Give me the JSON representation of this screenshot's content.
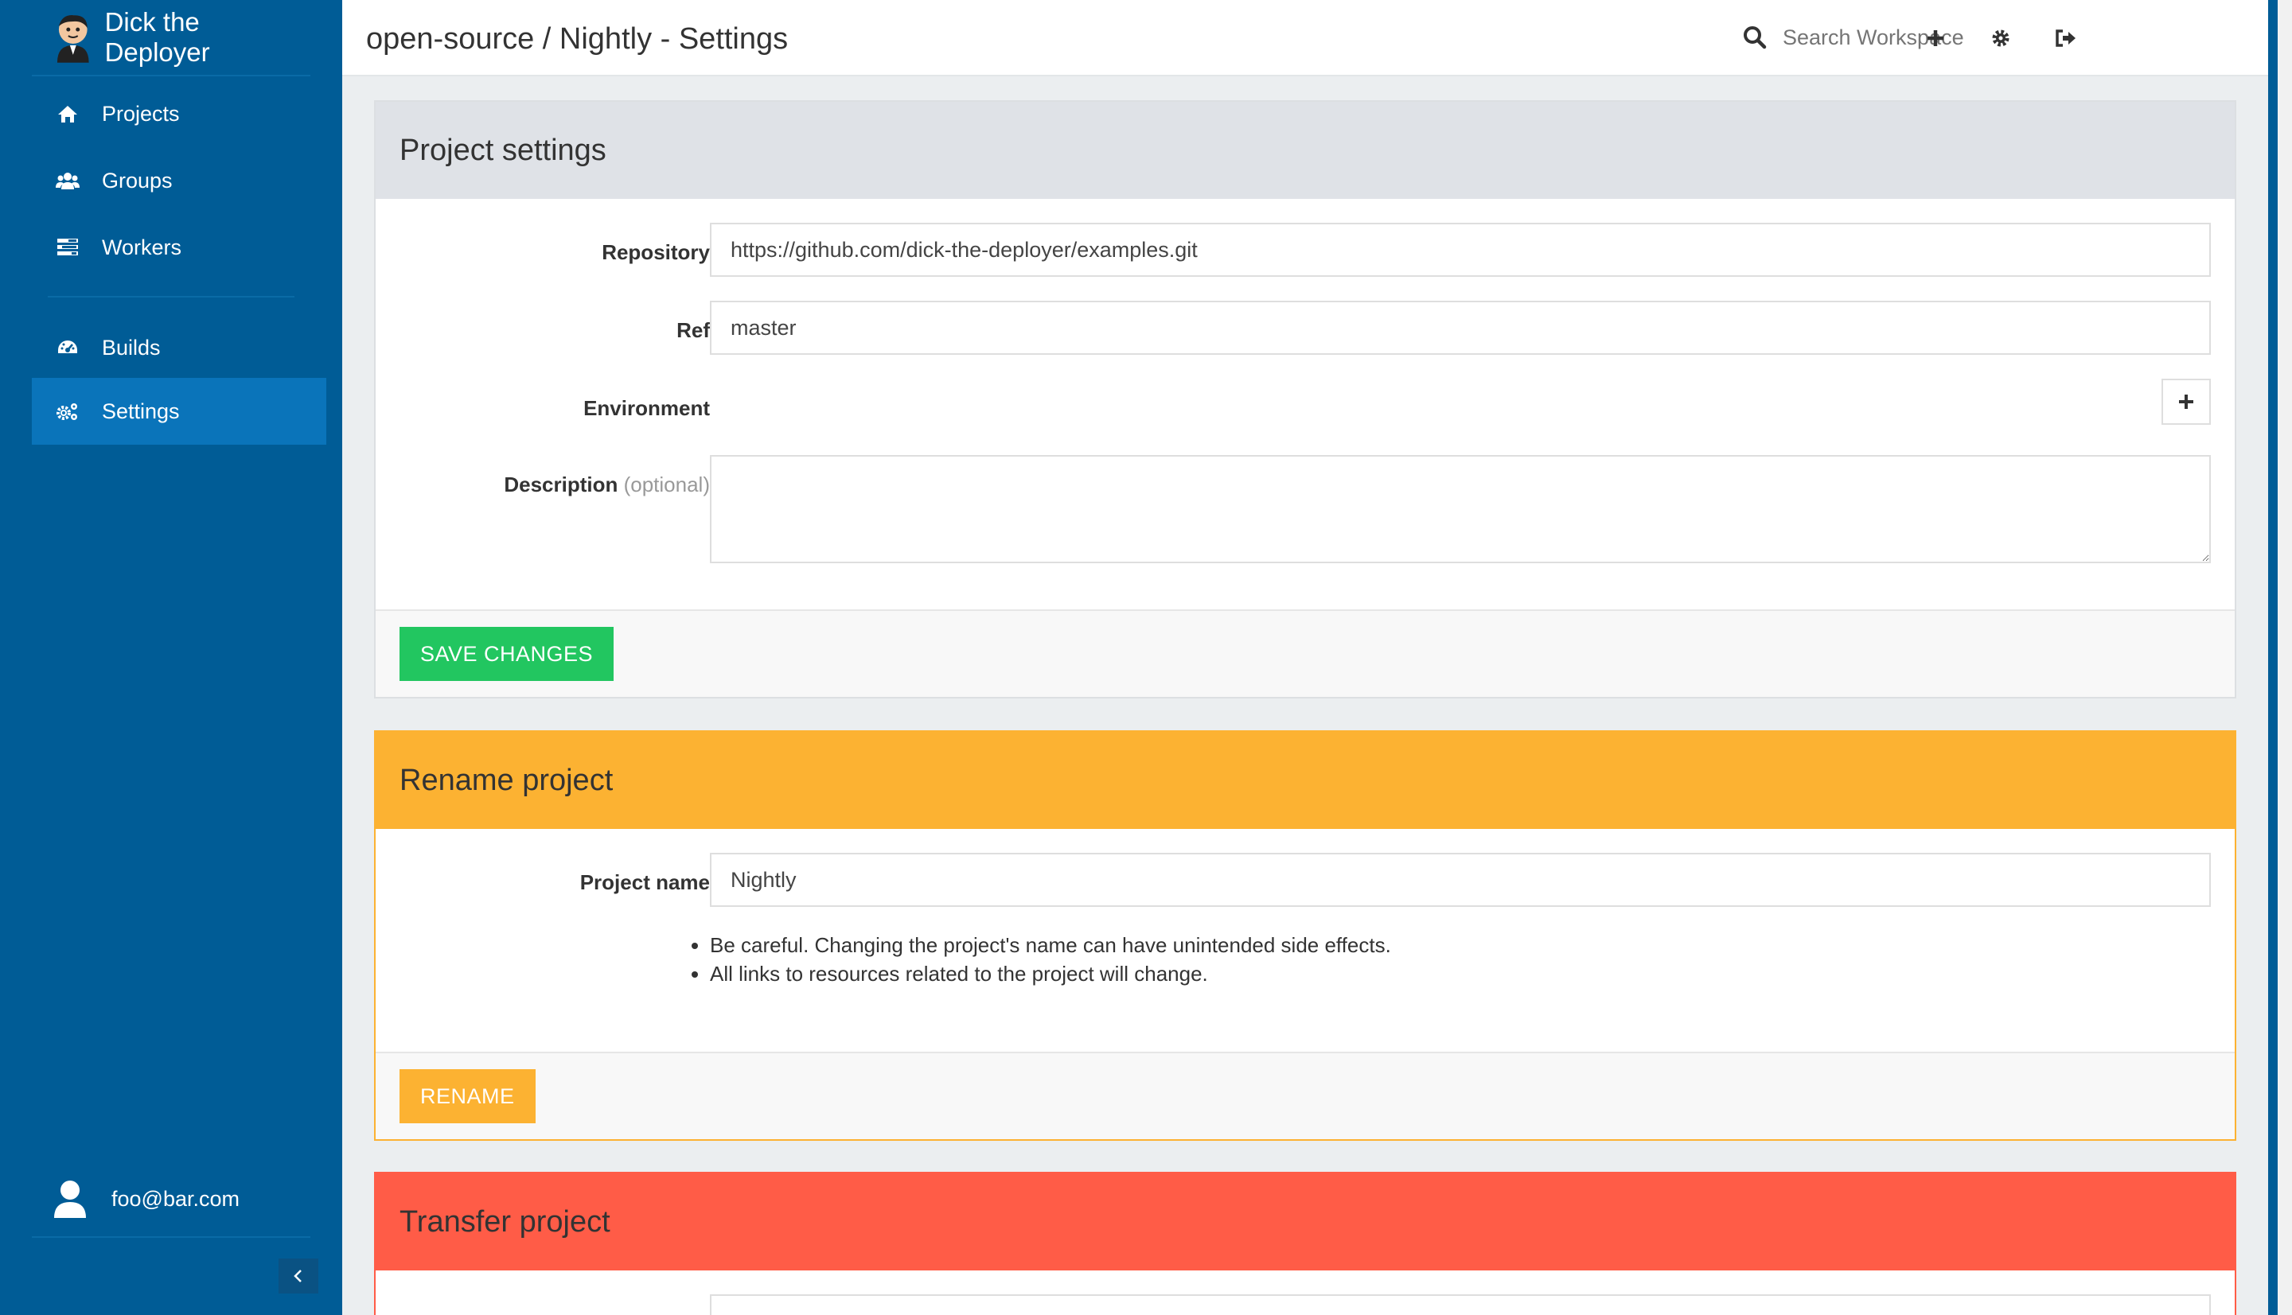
{
  "app": {
    "title": "Dick the Deployer"
  },
  "sidebar": {
    "items": [
      {
        "label": "Projects",
        "icon": "home-icon"
      },
      {
        "label": "Groups",
        "icon": "users-icon"
      },
      {
        "label": "Workers",
        "icon": "tasks-icon"
      },
      {
        "label": "Builds",
        "icon": "dashboard-icon"
      },
      {
        "label": "Settings",
        "icon": "cogs-icon",
        "active": true
      }
    ],
    "user_email": "foo@bar.com"
  },
  "header": {
    "title": "open-source / Nightly - Settings",
    "search_placeholder": "Search Workspace"
  },
  "project_settings": {
    "heading": "Project settings",
    "repository_label": "Repository",
    "repository_value": "https://github.com/dick-the-deployer/examples.git",
    "ref_label": "Ref",
    "ref_value": "master",
    "environment_label": "Environment",
    "description_label": "Description",
    "description_optional": "(optional)",
    "description_value": "",
    "save_label": "SAVE CHANGES"
  },
  "rename_project": {
    "heading": "Rename project",
    "name_label": "Project name",
    "name_value": "Nightly",
    "warnings": [
      "Be careful. Changing the project's name can have unintended side effects.",
      "All links to resources related to the project will change."
    ],
    "rename_label": "RENAME"
  },
  "transfer_project": {
    "heading": "Transfer project"
  },
  "colors": {
    "sidebar": "#005c96",
    "active": "#0a74ba",
    "success": "#22c660",
    "warning": "#fcb232",
    "danger": "#ff5c47"
  }
}
